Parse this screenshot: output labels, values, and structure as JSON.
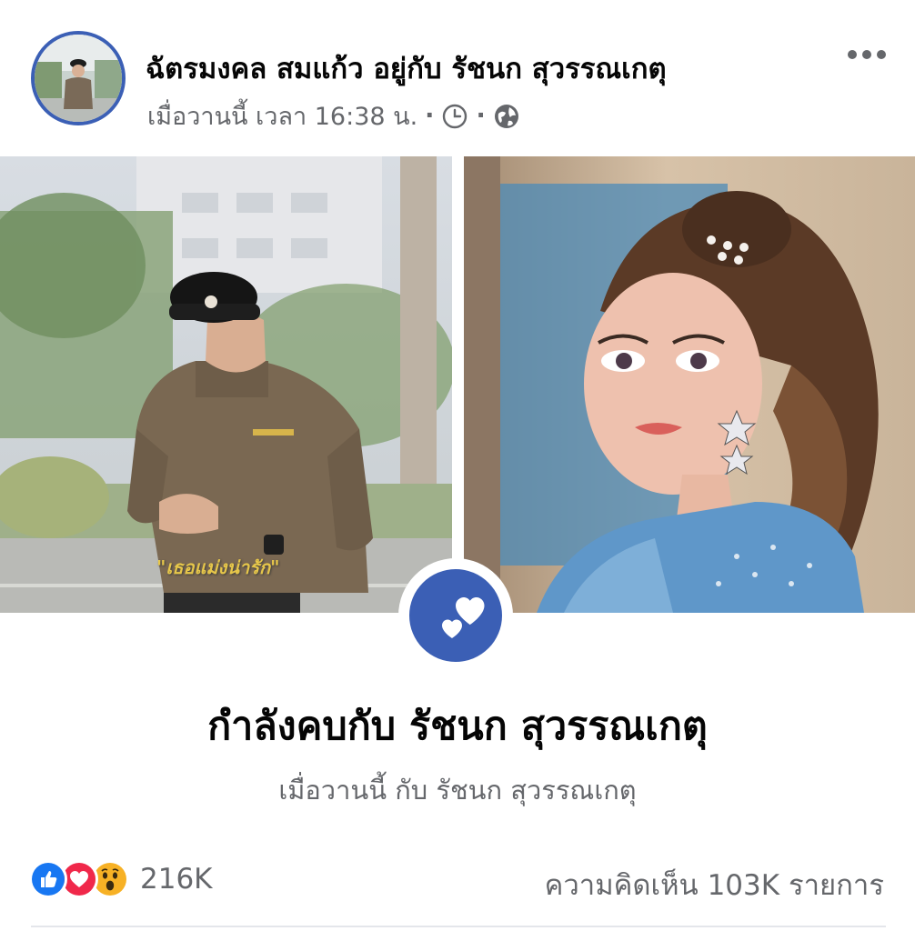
{
  "post": {
    "author": "ฉัตรมงคล สมแก้ว",
    "with_word": "อยู่กับ",
    "tagged_person": "รัชนก สุวรรณเกตุ",
    "timestamp": "เมื่อวานนี้ เวลา 16:38 น.",
    "dot": "·"
  },
  "photos": {
    "left_caption": "\"เธอแม่งน่ารัก\""
  },
  "life_event": {
    "title": "กำลังคบกับ รัชนก สุวรรณเกตุ",
    "subtitle": "เมื่อวานนี้ กับ รัชนก สุวรรณเกตุ",
    "icon": "two-hearts-icon"
  },
  "footer": {
    "reaction_icons": [
      "like-icon",
      "love-icon",
      "wow-icon"
    ],
    "reaction_count": "216K",
    "comments": "ความคิดเห็น 103K รายการ"
  },
  "colors": {
    "accent": "#3b5fb5",
    "like": "#1877f2",
    "love": "#f0284a",
    "wow": "#f7b125",
    "secondary_text": "#65676b"
  }
}
